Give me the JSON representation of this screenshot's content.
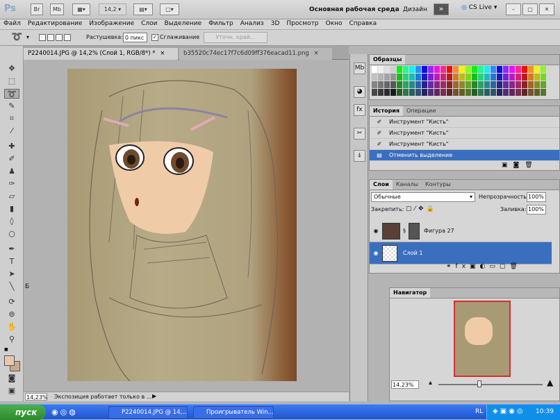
{
  "appbar": {
    "logo": "Ps",
    "btn_br": "Br",
    "btn_mb": "Mb",
    "zoom": "14,2",
    "workspace": "Основная рабочая среда",
    "design": "Дизайн",
    "cslive": "CS Live"
  },
  "menu": [
    "Файл",
    "Редактирование",
    "Изображение",
    "Слои",
    "Выделение",
    "Фильтр",
    "Анализ",
    "3D",
    "Просмотр",
    "Окно",
    "Справка"
  ],
  "options": {
    "feather_label": "Растушевка:",
    "feather_value": "0 пикс",
    "antialias_label": "Сглаживание",
    "refine_edge": "Уточн. край..."
  },
  "doctabs": {
    "active": "P2240014.JPG @ 14,2% (Слой 1, RGB/8*) *",
    "inactive": "b35520c74ec17f7c6d09ff376eacad11.png"
  },
  "docstatus": {
    "zoom": "14,23%",
    "info": "Экспозиция работает только в ..."
  },
  "swatches": {
    "tab": "Образцы"
  },
  "history": {
    "tabs": [
      "История",
      "Операции"
    ],
    "items": [
      {
        "label": "Инструмент \"Кисть\""
      },
      {
        "label": "Инструмент \"Кисть\""
      },
      {
        "label": "Инструмент \"Кисть\""
      },
      {
        "label": "Отменить выделение"
      }
    ]
  },
  "layers": {
    "tabs": [
      "Слои",
      "Каналы",
      "Контуры"
    ],
    "blend_mode": "Обычные",
    "opacity_label": "Непрозрачность:",
    "opacity_value": "100%",
    "lock_label": "Закрепить:",
    "fill_label": "Заливка:",
    "fill_value": "100%",
    "items": [
      {
        "name": "Фигура 27"
      },
      {
        "name": "Слой 1"
      }
    ]
  },
  "navigator": {
    "tab": "Навигатор",
    "zoom": "14.23%"
  },
  "taskbar": {
    "start": "пуск",
    "tasks": [
      "P2240014.JPG @ 14,...",
      "Проигрыватель Win..."
    ],
    "lang": "RL",
    "time": "10:39"
  },
  "colors": {
    "selection": "#3a6fc0",
    "taskbar": "#245edb",
    "start": "#3c9c3c"
  }
}
